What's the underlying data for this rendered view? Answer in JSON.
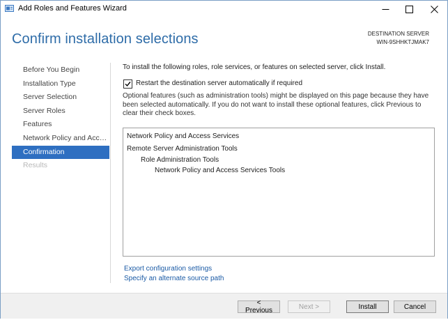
{
  "window": {
    "title": "Add Roles and Features Wizard",
    "minimize_glyph": "—",
    "maximize_glyph": "☐",
    "close_glyph": "✕"
  },
  "header": {
    "title": "Confirm installation selections",
    "destination_label": "DESTINATION SERVER",
    "destination_server": "WIN-9SHHKTJMAK7"
  },
  "nav": {
    "items": [
      {
        "label": "Before You Begin",
        "state": "normal"
      },
      {
        "label": "Installation Type",
        "state": "normal"
      },
      {
        "label": "Server Selection",
        "state": "normal"
      },
      {
        "label": "Server Roles",
        "state": "normal"
      },
      {
        "label": "Features",
        "state": "normal"
      },
      {
        "label": "Network Policy and Acces...",
        "state": "normal"
      },
      {
        "label": "Confirmation",
        "state": "active"
      },
      {
        "label": "Results",
        "state": "disabled"
      }
    ]
  },
  "main": {
    "intro": "To install the following roles, role services, or features on selected server, click Install.",
    "restart_checkbox": {
      "label": "Restart the destination server automatically if required",
      "checked": true
    },
    "note": "Optional features (such as administration tools) might be displayed on this page because they have been selected automatically. If you do not want to install these optional features, click Previous to clear their check boxes.",
    "selections": [
      {
        "label": "Network Policy and Access Services",
        "level": 0
      },
      {
        "label": "Remote Server Administration Tools",
        "level": 0
      },
      {
        "label": "Role Administration Tools",
        "level": 1
      },
      {
        "label": "Network Policy and Access Services Tools",
        "level": 2
      }
    ],
    "links": {
      "export": "Export configuration settings",
      "alternate_source": "Specify an alternate source path"
    }
  },
  "footer": {
    "previous": "< Previous",
    "next": "Next >",
    "install": "Install",
    "cancel": "Cancel"
  },
  "colors": {
    "accent": "#2e6fc1",
    "title_blue": "#2e6ca8",
    "link_blue": "#1a5aa5"
  }
}
